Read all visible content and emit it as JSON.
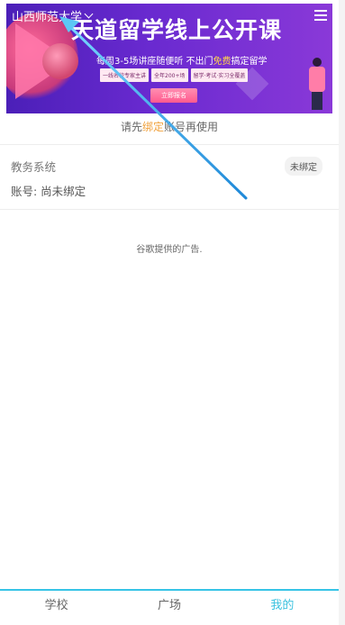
{
  "header": {
    "school_name": "山西师范大学"
  },
  "banner": {
    "title": "天道留学线上公开课",
    "subtitle_prefix": "每周3-5场讲座随便听 不出门",
    "subtitle_highlight": "免费",
    "subtitle_suffix": "搞定留学",
    "chips": [
      "一线名校专家主讲",
      "全年200+场",
      "留学·考试·实习全覆盖"
    ],
    "cta": "立即报名"
  },
  "bind_hint": {
    "before": "请先",
    "link": "绑定",
    "after": "账号再使用"
  },
  "edu_system": {
    "title": "教务系统",
    "status": "未绑定",
    "account": "账号: 尚未绑定"
  },
  "ad": {
    "text": "谷歌提供的广告."
  },
  "bottom_nav": {
    "items": [
      {
        "label": "学校"
      },
      {
        "label": "广场"
      },
      {
        "label": "我的"
      }
    ]
  },
  "colors": {
    "accent": "#3cc2df",
    "link": "#f0a13c",
    "banner_start": "#4b1fb8",
    "banner_end": "#8a39d8"
  }
}
